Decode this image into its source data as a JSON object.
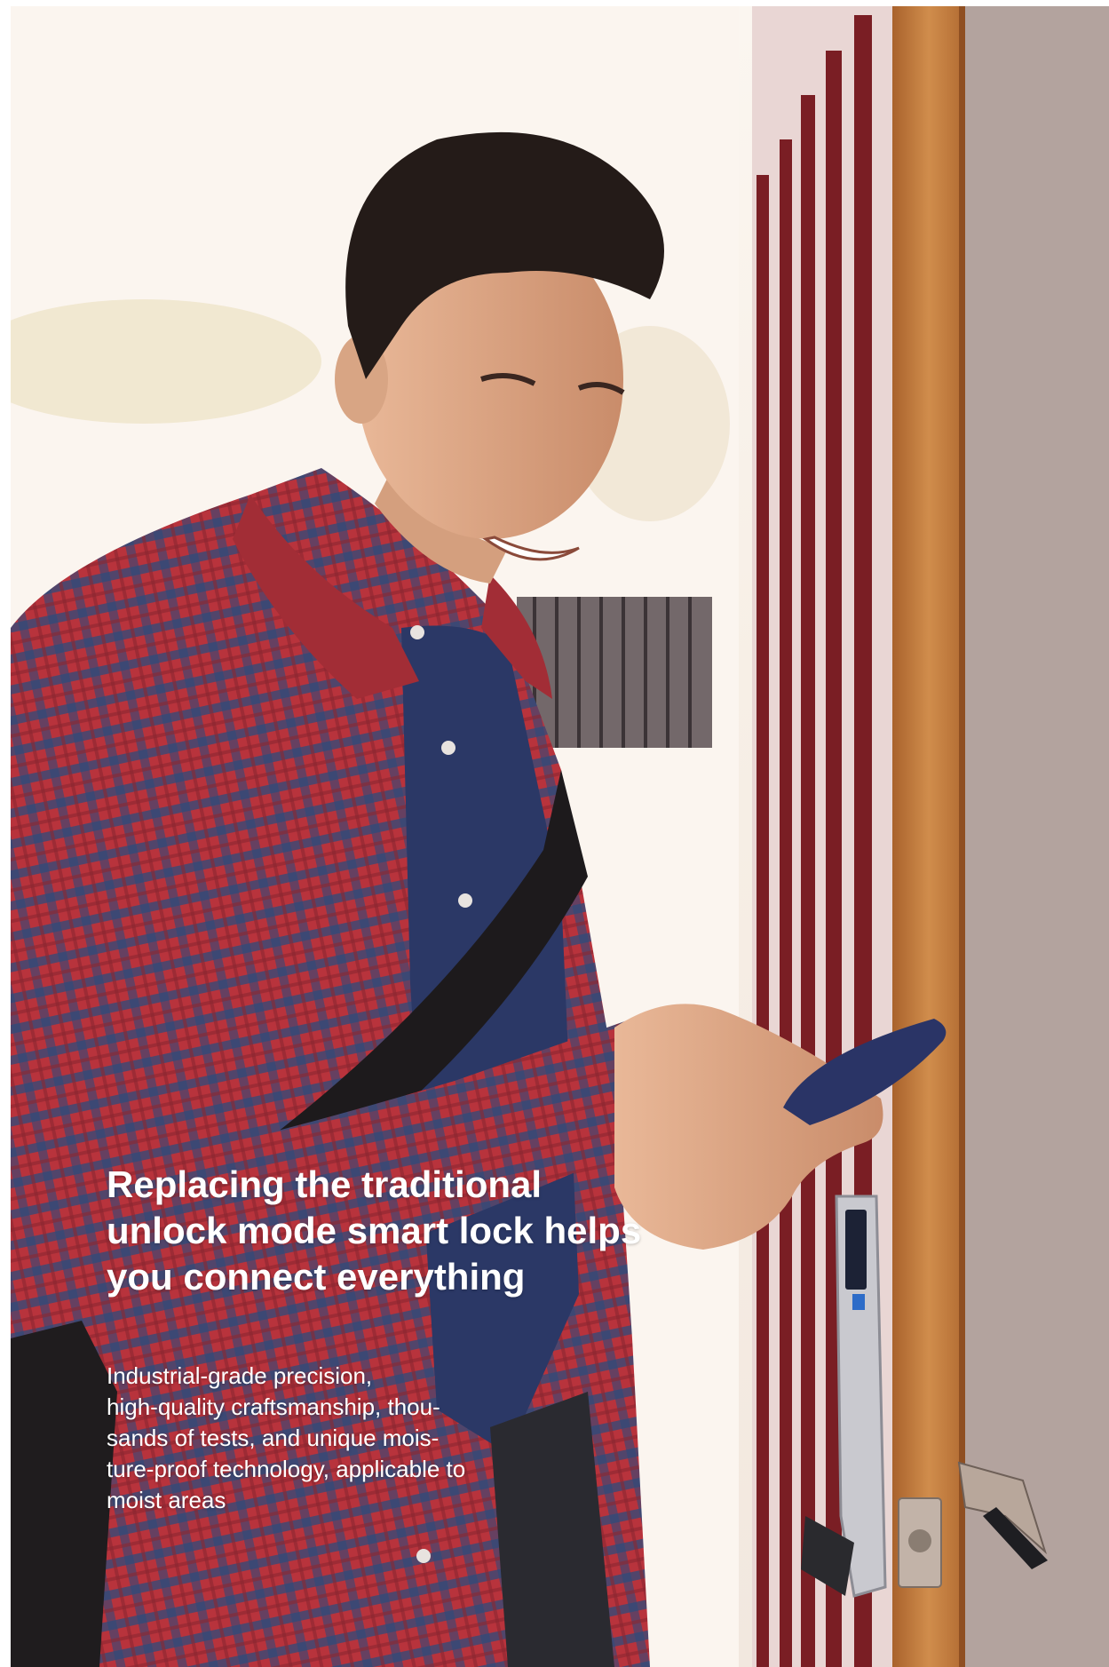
{
  "headline": "Replacing the traditional\nunlock mode smart lock helps\nyou connect everything",
  "body": "Industrial-grade precision,\nhigh-quality craftsmanship, thou-\nsands of tests, and unique mois-\nture-proof technology, applicable to\nmoist areas",
  "colors": {
    "text": "#ffffff",
    "shirt_red": "#b8333c",
    "shirt_blue": "#2e4a7a",
    "door_red": "#7a1e24",
    "door_frame": "#c07a3e",
    "wall": "#b3a39e",
    "phone": "#2a3466"
  }
}
